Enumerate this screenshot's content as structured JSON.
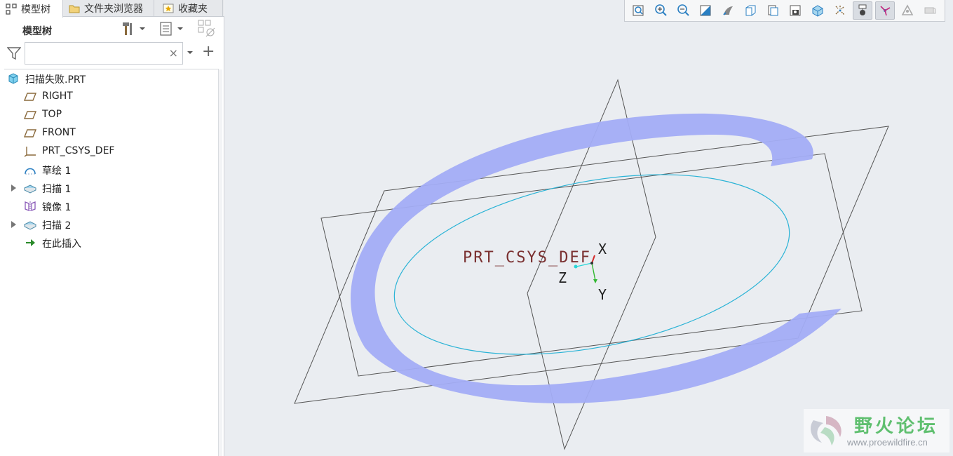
{
  "tabs": [
    {
      "label": "模型树",
      "icon": "model-tree-icon",
      "active": true
    },
    {
      "label": "文件夹浏览器",
      "icon": "folder-browser-icon",
      "active": false
    },
    {
      "label": "收藏夹",
      "icon": "favorites-icon",
      "active": false
    }
  ],
  "tree_header": {
    "title": "模型树"
  },
  "search": {
    "value": "",
    "placeholder": "",
    "clear_glyph": "×",
    "add_glyph": "+"
  },
  "tree_items": [
    {
      "label": "扫描失败.PRT",
      "icon": "part-icon",
      "expandable": false
    },
    {
      "label": "RIGHT",
      "icon": "datum-plane-icon",
      "expandable": false
    },
    {
      "label": "TOP",
      "icon": "datum-plane-icon",
      "expandable": false
    },
    {
      "label": "FRONT",
      "icon": "datum-plane-icon",
      "expandable": false
    },
    {
      "label": "PRT_CSYS_DEF",
      "icon": "csys-icon",
      "expandable": false
    },
    {
      "label": "草绘 1",
      "icon": "sketch-icon",
      "expandable": false
    },
    {
      "label": "扫描 1",
      "icon": "sweep-icon",
      "expandable": true
    },
    {
      "label": "镜像 1",
      "icon": "mirror-icon",
      "expandable": false
    },
    {
      "label": "扫描 2",
      "icon": "sweep-icon",
      "expandable": true
    },
    {
      "label": "在此插入",
      "icon": "insert-here-arrow-icon",
      "expandable": false
    }
  ],
  "toolbar": [
    {
      "icon": "refit-icon",
      "active": false
    },
    {
      "icon": "zoom-in-icon",
      "active": false
    },
    {
      "icon": "zoom-out-icon",
      "active": false
    },
    {
      "icon": "repaint-icon",
      "active": false
    },
    {
      "icon": "perspective-icon",
      "active": false
    },
    {
      "icon": "display-style-icon",
      "active": false
    },
    {
      "icon": "saved-orientations-icon",
      "active": false
    },
    {
      "icon": "view-manager-icon",
      "active": false
    },
    {
      "icon": "section-icon",
      "active": false
    },
    {
      "icon": "datum-display-icon",
      "active": false
    },
    {
      "icon": "annotation-display-icon",
      "active": true
    },
    {
      "icon": "spin-center-icon",
      "active": true
    },
    {
      "icon": "appearance-icon",
      "active": false
    },
    {
      "icon": "render-icon",
      "active": false
    }
  ],
  "scene": {
    "csys_label": "PRT_CSYS_DEF",
    "axis_x": "X",
    "axis_y": "Y",
    "axis_z": "Z",
    "sweep_color": "#a3adf5",
    "trajectory_color": "#2ab3d6",
    "plane_color": "#555555"
  },
  "watermark": {
    "title": "野火论坛",
    "url": "www.proewildfire.cn"
  }
}
